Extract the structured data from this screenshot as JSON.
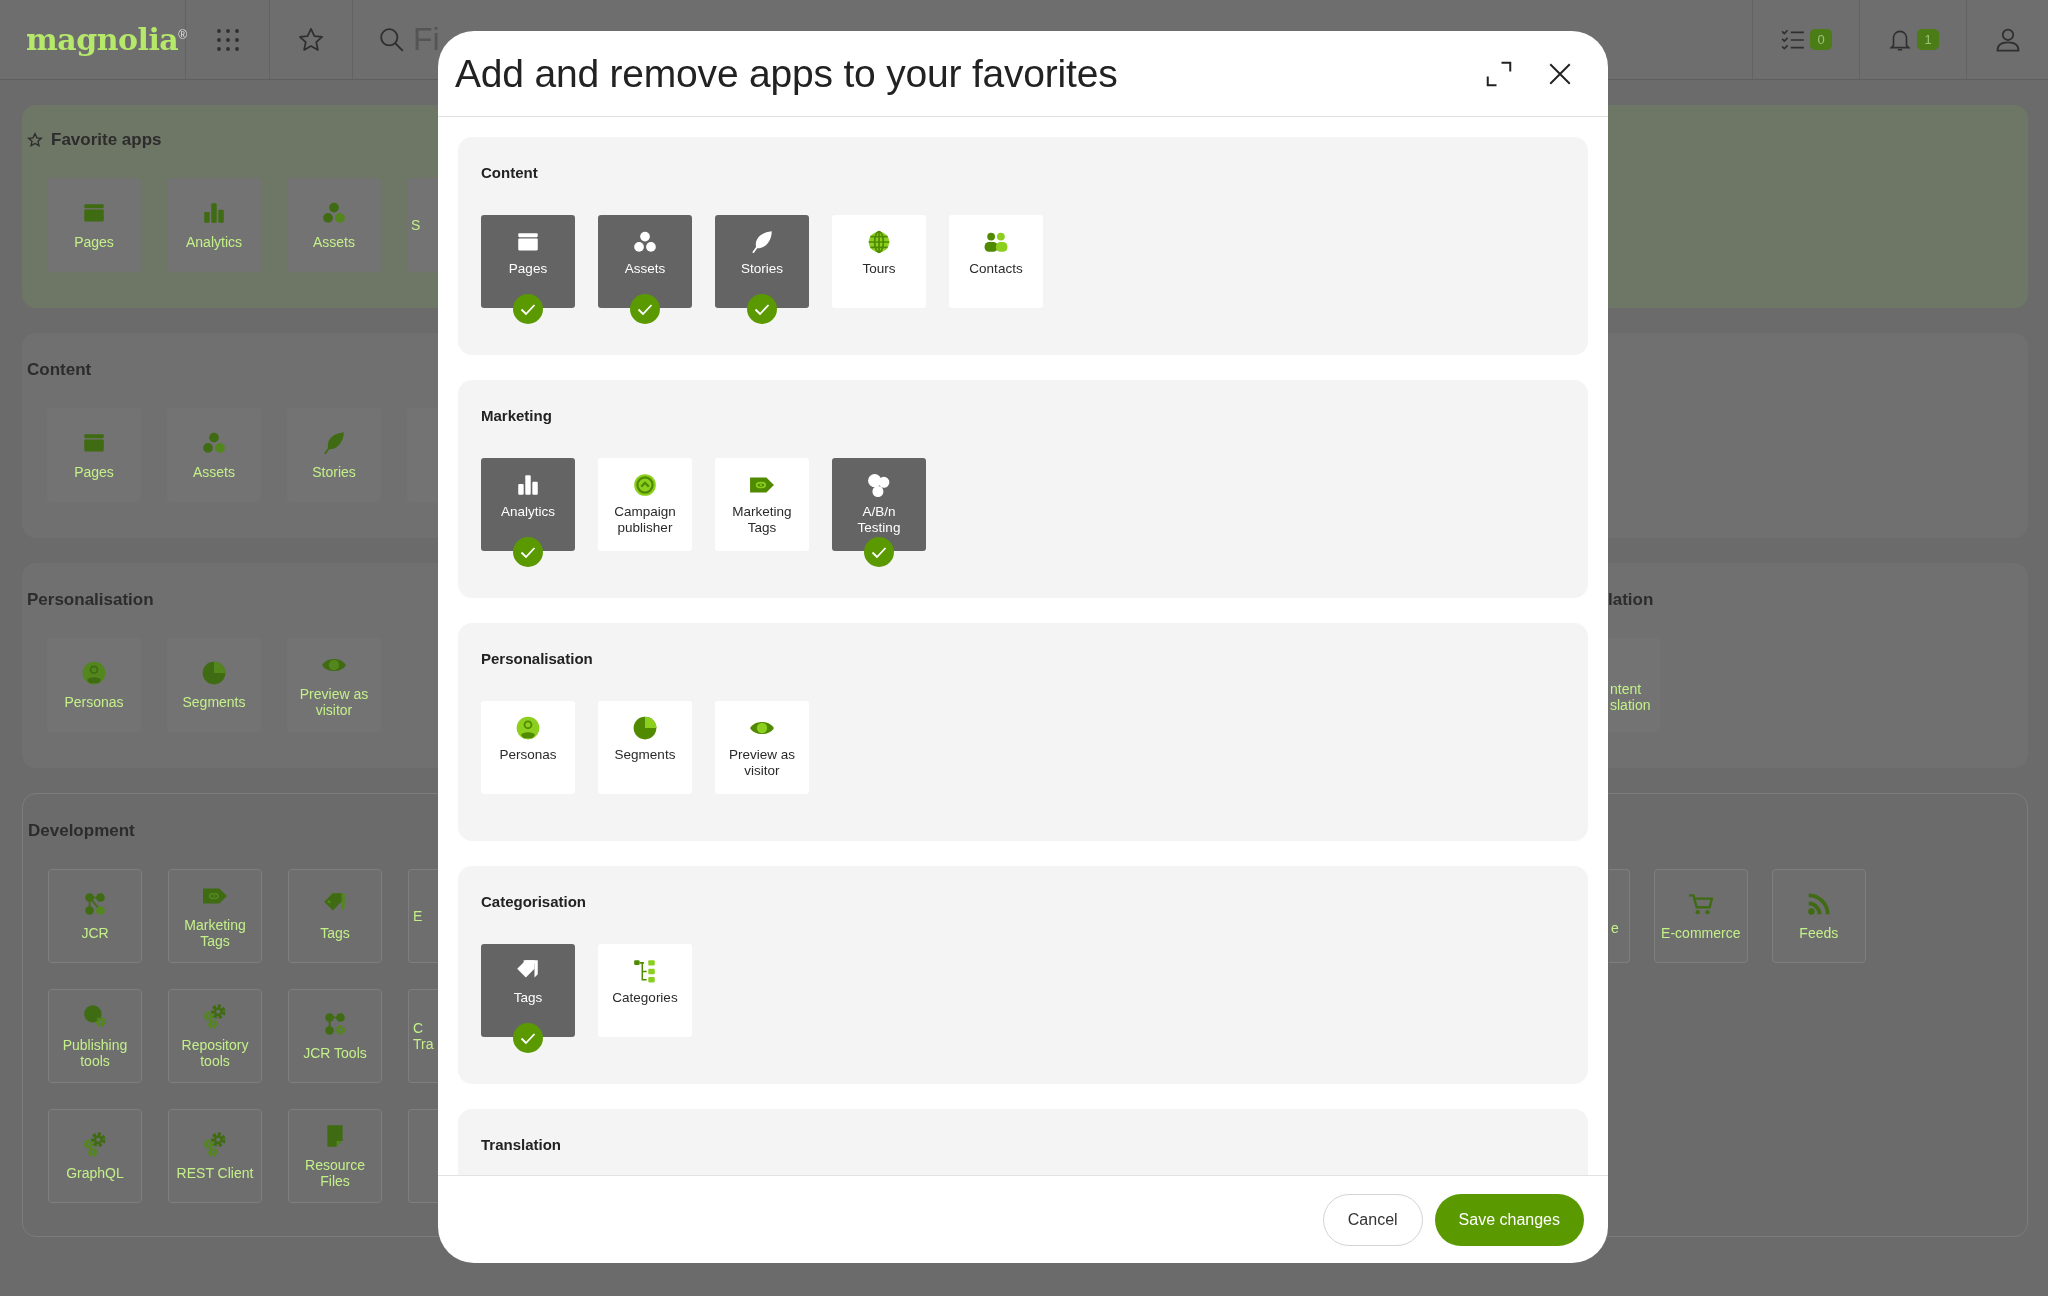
{
  "topbar": {
    "logo": "magnolia$^{®}$",
    "search": {
      "placeholder": "Fi"
    },
    "tasks_badge": "0",
    "notifications_badge": "1"
  },
  "background": {
    "sections": [
      {
        "kind": "favorites",
        "title": "Favorite apps",
        "rows": [
          {
            "left": [
              {
                "label": "Pages",
                "kind": "pages"
              },
              {
                "label": "Analytics",
                "kind": "analytics"
              },
              {
                "label": "Assets",
                "kind": "assets"
              },
              {
                "label": "S",
                "kind": "partial"
              }
            ]
          }
        ]
      },
      {
        "kind": "plain",
        "title": "Content",
        "rows": [
          {
            "left": [
              {
                "label": "Pages",
                "kind": "pages"
              },
              {
                "label": "Assets",
                "kind": "assets"
              },
              {
                "label": "Stories",
                "kind": "stories"
              },
              {
                "kind": "partial"
              }
            ]
          }
        ]
      },
      {
        "kind": "plain",
        "title": "Personalisation",
        "title_right": "lation",
        "rows": [
          {
            "left": [
              {
                "label": "Personas",
                "kind": "personas"
              },
              {
                "label": "Segments",
                "kind": "segments"
              },
              {
                "label": "Preview as visitor",
                "kind": "preview"
              }
            ],
            "right": [
              {
                "label": "ntent\nslation",
                "kind": "partial"
              }
            ]
          }
        ]
      },
      {
        "kind": "outlined",
        "title": "Development",
        "rows": [
          {
            "left": [
              {
                "label": "JCR",
                "kind": "jcr"
              },
              {
                "label": "Marketing Tags",
                "kind": "marketing-tags"
              },
              {
                "label": "Tags",
                "kind": "tags"
              },
              {
                "label": "E",
                "kind": "partial"
              }
            ],
            "right": [
              {
                "label": "e",
                "kind": "partial"
              },
              {
                "label": "E-commerce",
                "kind": "ecommerce"
              },
              {
                "label": "Feeds",
                "kind": "feeds"
              }
            ]
          },
          {
            "left": [
              {
                "label": "Publishing tools",
                "kind": "publishing"
              },
              {
                "label": "Repository tools",
                "kind": "gears"
              },
              {
                "label": "JCR Tools",
                "kind": "jcr-tools"
              },
              {
                "label": "C\nTra",
                "kind": "partial"
              }
            ]
          },
          {
            "left": [
              {
                "label": "GraphQL",
                "kind": "gears"
              },
              {
                "label": "REST Client",
                "kind": "gears"
              },
              {
                "label": "Resource Files",
                "kind": "resource"
              },
              {
                "kind": "partial"
              }
            ]
          }
        ]
      }
    ]
  },
  "dialog": {
    "title": "Add and remove apps to your favorites",
    "sections": [
      {
        "title": "Content",
        "apps": [
          {
            "label": "Pages",
            "kind": "pages",
            "selected": true
          },
          {
            "label": "Assets",
            "kind": "assets",
            "selected": true
          },
          {
            "label": "Stories",
            "kind": "stories",
            "selected": true
          },
          {
            "label": "Tours",
            "kind": "tours",
            "selected": false
          },
          {
            "label": "Contacts",
            "kind": "contacts",
            "selected": false
          }
        ]
      },
      {
        "title": "Marketing",
        "apps": [
          {
            "label": "Analytics",
            "kind": "analytics",
            "selected": true
          },
          {
            "label": "Campaign publisher",
            "kind": "campaign",
            "selected": false
          },
          {
            "label": "Marketing Tags",
            "kind": "marketing-tags",
            "selected": false
          },
          {
            "label": "A/B/n Testing",
            "kind": "abn",
            "selected": true
          }
        ]
      },
      {
        "title": "Personalisation",
        "apps": [
          {
            "label": "Personas",
            "kind": "personas",
            "selected": false
          },
          {
            "label": "Segments",
            "kind": "segments",
            "selected": false
          },
          {
            "label": "Preview as visitor",
            "kind": "preview",
            "selected": false
          }
        ]
      },
      {
        "title": "Categorisation",
        "apps": [
          {
            "label": "Tags",
            "kind": "tags",
            "selected": true
          },
          {
            "label": "Categories",
            "kind": "categories",
            "selected": false
          }
        ]
      },
      {
        "title": "Translation"
      }
    ],
    "buttons": [
      {
        "label": "Cancel",
        "kind": "secondary"
      },
      {
        "label": "Save changes",
        "kind": "primary"
      }
    ]
  }
}
